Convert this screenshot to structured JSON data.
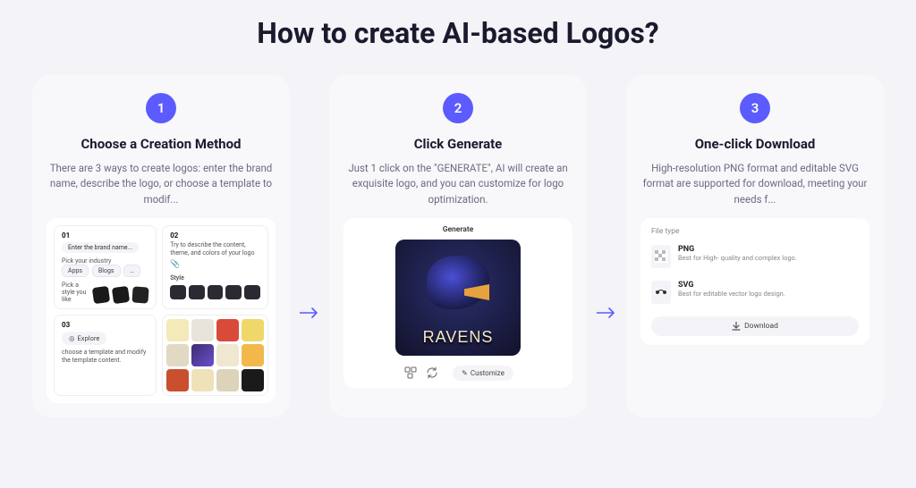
{
  "title": "How to create AI-based Logos?",
  "steps": [
    {
      "num": "1",
      "title": "Choose a Creation Method",
      "desc": "There are 3 ways to create logos: enter the brand name, describe the logo, or choose a template to modif...",
      "illus": {
        "box1_label": "01",
        "box1_placeholder": "Enter the brand name...",
        "box1_sub": "Pick your industry",
        "box1_chip1": "Apps",
        "box1_chip2": "Blogs",
        "box1_sub2": "Pick a style you like",
        "box2_label": "02",
        "box2_text": "Try to describe the content, theme, and colors of your logo",
        "box2_style": "Style",
        "box3_label": "03",
        "box3_btn": "Explore",
        "box3_sub": "choose a template and modify the template content."
      }
    },
    {
      "num": "2",
      "title": "Click Generate",
      "desc": "Just 1 click on the \"GENERATE\", AI will create an exquisite logo, and you can customize for logo optimization.",
      "illus": {
        "generate": "Generate",
        "logo_text": "RAVENS",
        "customize": "Customize"
      }
    },
    {
      "num": "3",
      "title": "One-click Download",
      "desc": "High-resolution PNG format and editable SVG format are supported for download, meeting your needs f...",
      "illus": {
        "file_type": "File type",
        "png_name": "PNG",
        "png_sub": "Best for High- quality and complex logo.",
        "svg_name": "SVG",
        "svg_sub": "Best for editable vector logo design.",
        "download": "Download"
      }
    }
  ]
}
